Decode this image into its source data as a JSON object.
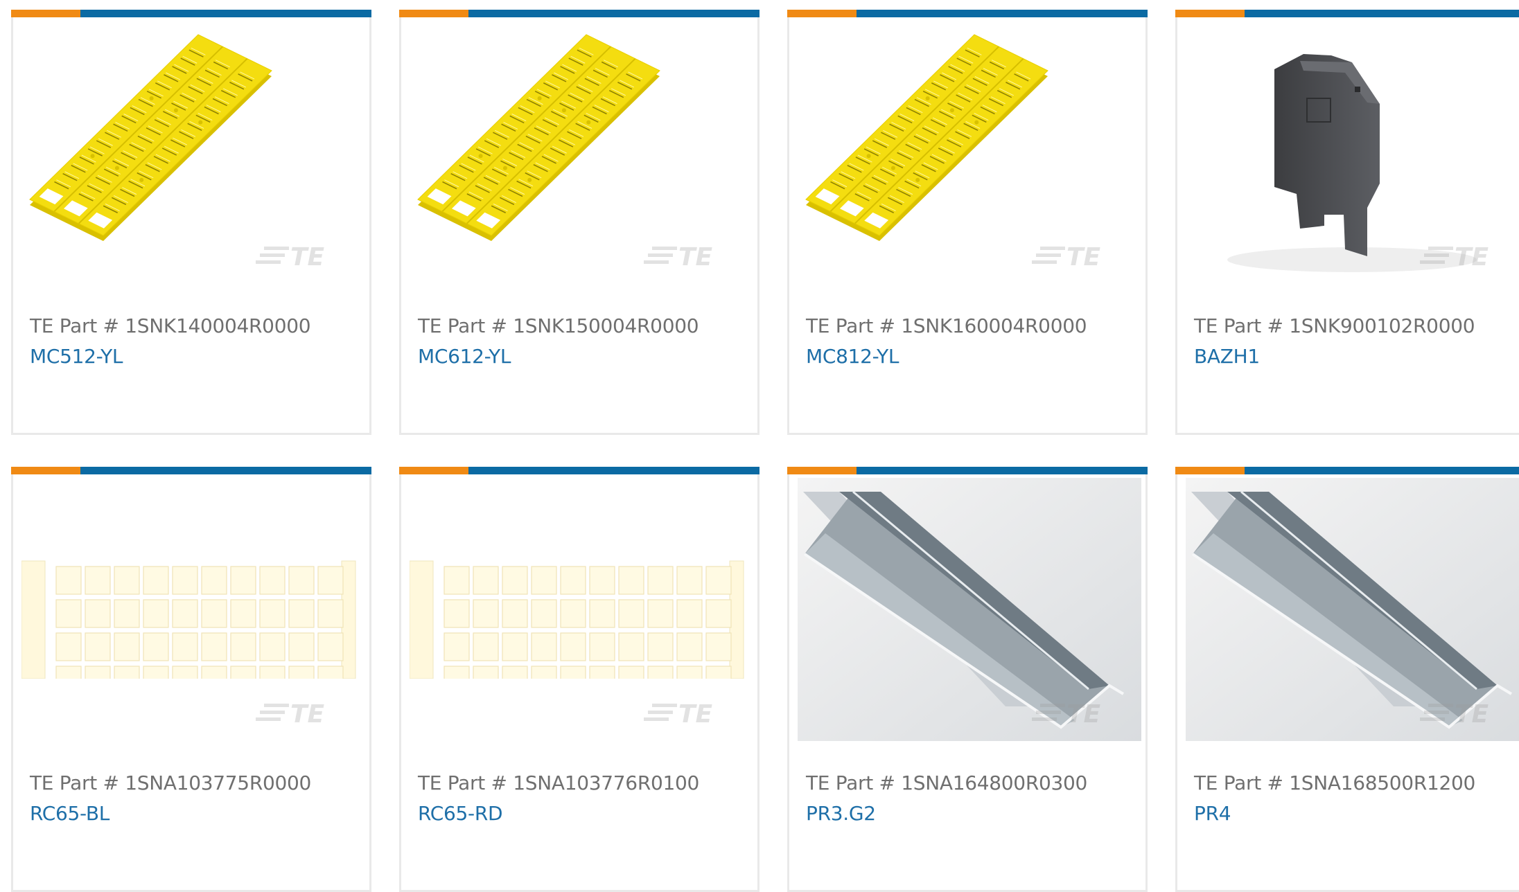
{
  "accent": {
    "orange": "#f08a14",
    "blue": "#0b6aa3",
    "link": "#1e6fa8"
  },
  "part_prefix": "TE Part #",
  "watermark": "TE",
  "products": [
    {
      "part_prefix": "TE Part #",
      "part_no": "1SNK140004R0000",
      "name": "MC512-YL",
      "image": "yellow-marker-card"
    },
    {
      "part_prefix": "TE Part #",
      "part_no": "1SNK150004R0000",
      "name": "MC612-YL",
      "image": "yellow-marker-card"
    },
    {
      "part_prefix": "TE Part #",
      "part_no": "1SNK160004R0000",
      "name": "MC812-YL",
      "image": "yellow-marker-card"
    },
    {
      "part_prefix": "TE Part #",
      "part_no": "1SNK900102R0000",
      "name": "BAZH1",
      "image": "grey-end-plate"
    },
    {
      "part_prefix": "TE Part #",
      "part_no": "1SNA103775R0000",
      "name": "RC65-BL",
      "image": "cream-marker-card"
    },
    {
      "part_prefix": "TE Part #",
      "part_no": "1SNA103776R0100",
      "name": "RC65-RD",
      "image": "cream-marker-card"
    },
    {
      "part_prefix": "TE Part #",
      "part_no": "1SNA164800R0300",
      "name": "PR3.G2",
      "image": "din-rail"
    },
    {
      "part_prefix": "TE Part #",
      "part_no": "1SNA168500R1200",
      "name": "PR4",
      "image": "din-rail"
    }
  ]
}
